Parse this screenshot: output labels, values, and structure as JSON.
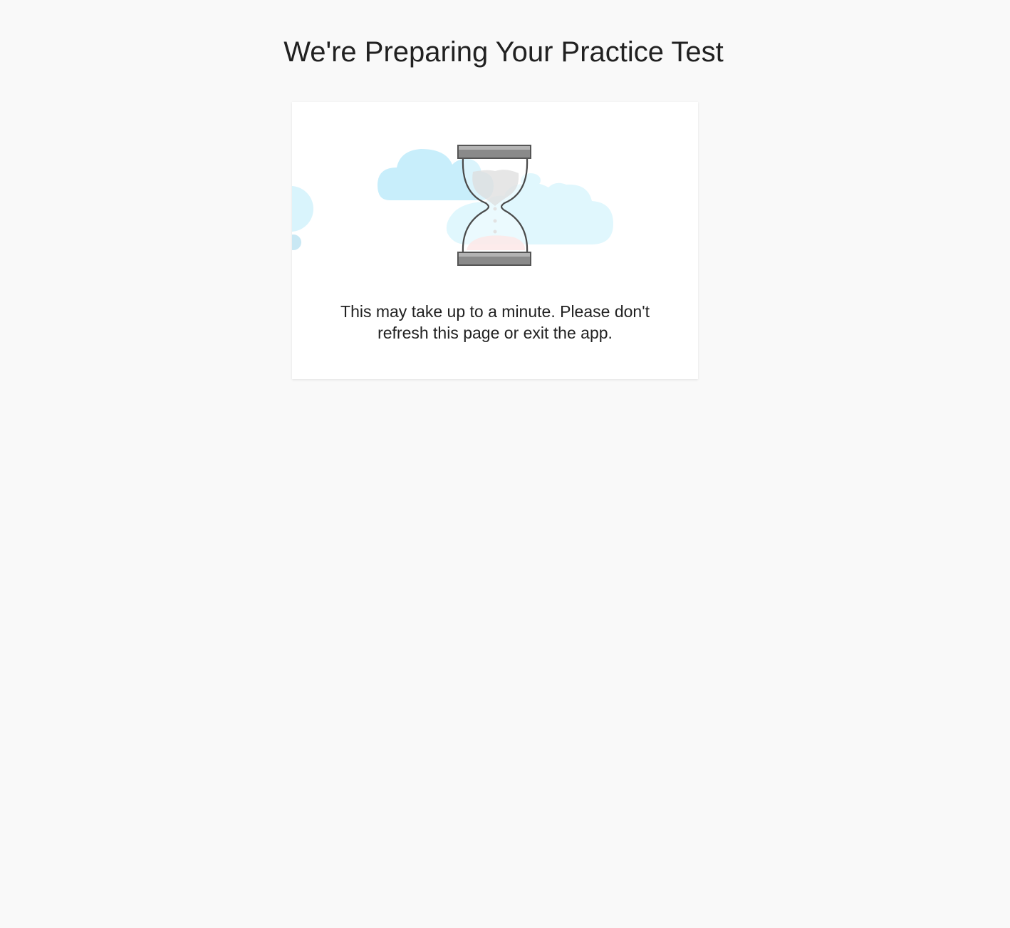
{
  "page": {
    "title": "We're Preparing Your Practice Test",
    "message": "This may take up to a minute. Please don't refresh this page or exit the app."
  },
  "illustration": {
    "icon": "hourglass-icon",
    "decorations": [
      "cloud-icon",
      "cloud-icon",
      "cloud-icon"
    ]
  },
  "colors": {
    "background": "#f9f9f9",
    "card": "#ffffff",
    "cloud_light": "#e0f7fd",
    "cloud": "#c8eefb",
    "hourglass_cap": "#8a8a8a",
    "hourglass_outline": "#4a4a4a",
    "sand": "#fbe3e3",
    "text": "#212121"
  }
}
